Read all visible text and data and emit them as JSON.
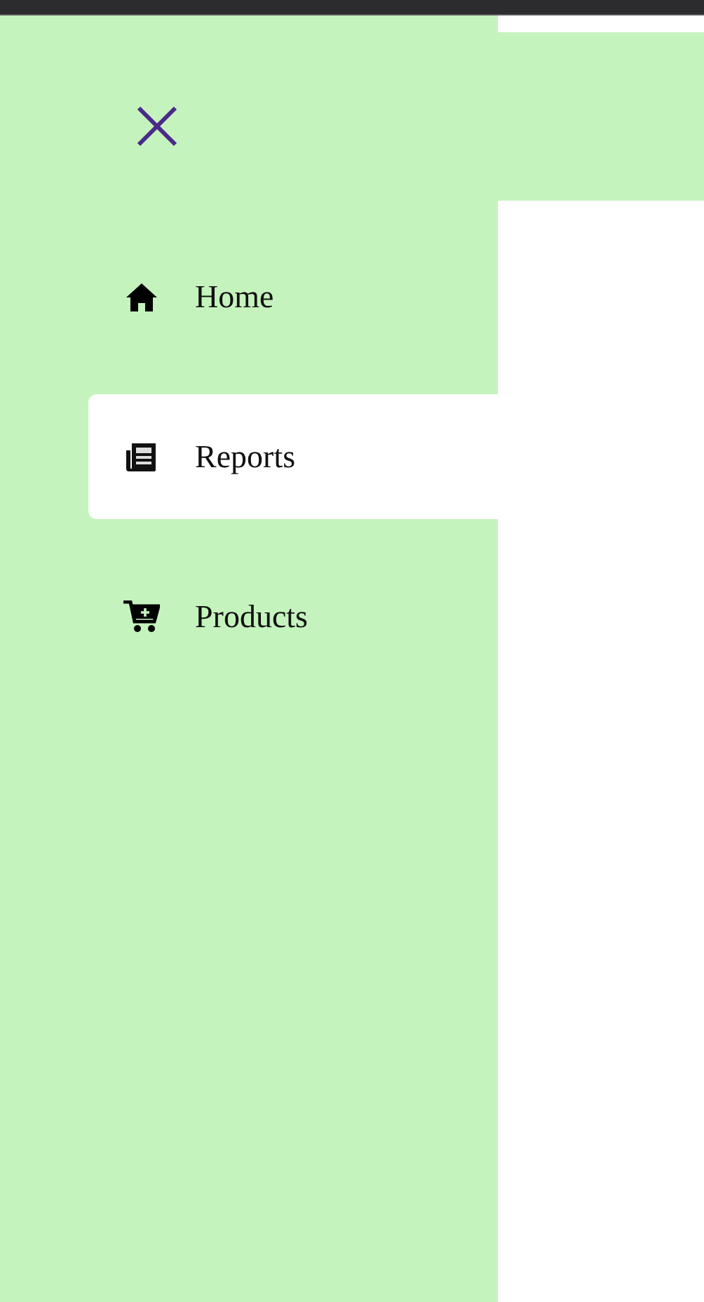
{
  "sidebar": {
    "items": [
      {
        "label": "Home",
        "kind": "home",
        "selected": false
      },
      {
        "label": "Reports",
        "kind": "reports",
        "selected": true
      },
      {
        "label": "Products",
        "kind": "cart",
        "selected": false
      }
    ]
  }
}
